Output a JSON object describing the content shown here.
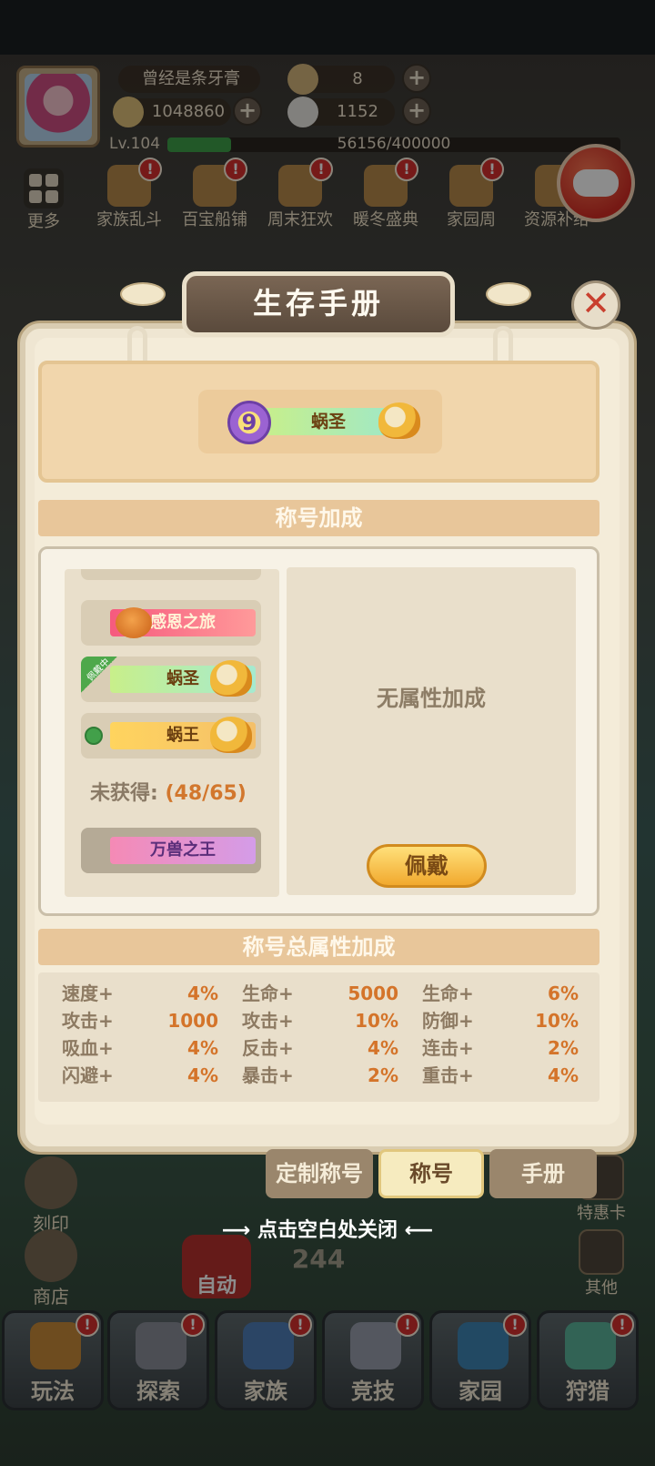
{
  "player": {
    "name": "曾经是条牙膏",
    "tickets": "8",
    "coins": "1048860",
    "shells": "1152",
    "level": "Lv.104",
    "xp_text": "56156/400000",
    "xp_fraction": 0.14
  },
  "more_label": "更多",
  "events": [
    "家族乱斗",
    "百宝船铺",
    "周末狂欢",
    "暖冬盛典",
    "家园周",
    "资源补给"
  ],
  "dialog": {
    "title": "生存手册",
    "current_title": {
      "level": "9",
      "name": "蜗圣"
    },
    "section_bonus": "称号加成",
    "titles_list": [
      {
        "name": "感恩之旅",
        "style": "pink"
      },
      {
        "name": "蜗圣",
        "style": "green",
        "tag": "佩戴中"
      },
      {
        "name": "蜗王",
        "style": "gold"
      }
    ],
    "unobtained_label": "未获得:",
    "unobtained_count": "(48/65)",
    "locked_titles": [
      {
        "name": "万兽之王",
        "style": "purple"
      }
    ],
    "no_attr_text": "无属性加成",
    "wear_button": "佩戴",
    "section_total": "称号总属性加成",
    "stats": [
      {
        "k": "速度+",
        "v": "4%"
      },
      {
        "k": "生命+",
        "v": "5000"
      },
      {
        "k": "生命+",
        "v": "6%"
      },
      {
        "k": "攻击+",
        "v": "1000"
      },
      {
        "k": "攻击+",
        "v": "10%"
      },
      {
        "k": "防御+",
        "v": "10%"
      },
      {
        "k": "吸血+",
        "v": "4%"
      },
      {
        "k": "反击+",
        "v": "4%"
      },
      {
        "k": "连击+",
        "v": "2%"
      },
      {
        "k": "闪避+",
        "v": "4%"
      },
      {
        "k": "暴击+",
        "v": "2%"
      },
      {
        "k": "重击+",
        "v": "4%"
      }
    ],
    "tabs": [
      "定制称号",
      "称号",
      "手册"
    ],
    "active_tab": "称号",
    "close_hint": "点击空白处关闭"
  },
  "side_left": [
    "刻印",
    "商店"
  ],
  "side_right": [
    "特惠卡",
    "其他"
  ],
  "auto_label": "自动",
  "energy": "244",
  "bottom_nav": [
    "玩法",
    "探索",
    "家族",
    "竞技",
    "家园",
    "狩猎"
  ],
  "colors": {
    "accent": "#d4742a",
    "badge": "#d7312e",
    "section": "#e8c69a"
  }
}
